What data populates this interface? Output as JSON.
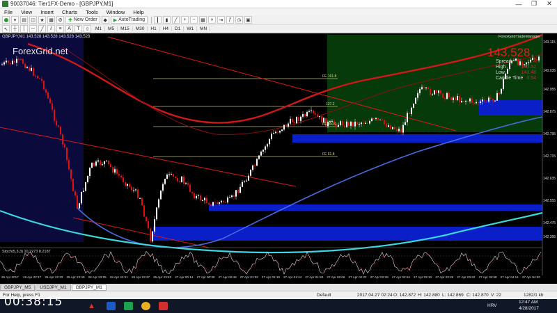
{
  "window": {
    "title": "90037046: Tier1FX-Demo - [GBPJPY,M1]",
    "controls": [
      "—",
      "❐",
      "✕"
    ]
  },
  "menu": [
    "File",
    "View",
    "Insert",
    "Charts",
    "Tools",
    "Window",
    "Help"
  ],
  "toolbar": {
    "new_order_label": "New Order",
    "autotrading_label": "AutoTrading",
    "timeframes": [
      "M1",
      "M5",
      "M15",
      "M30",
      "H1",
      "H4",
      "D1",
      "W1",
      "MN"
    ]
  },
  "chart": {
    "header": "GBPJPY,M1  143.528 143.528 143.528 143.528",
    "watermark": "ForexGrid.net",
    "manager_label": "ForexGridTradeManager",
    "current_price": "143.528",
    "info": [
      {
        "label": "Spread",
        "value": "2.4"
      },
      {
        "label": "High",
        "value": "143.52"
      },
      {
        "label": "Low",
        "value": "143.48"
      },
      {
        "label": "Candle Time",
        "value": "0:54"
      }
    ],
    "fib_labels": [
      "FE 161.8",
      "127.2",
      "FE 100.0",
      "FE 61.8"
    ],
    "stoch_label": "Stoch(5,3,3) 10.2273 8.2187",
    "price_axis": [
      "143.115",
      "143.035",
      "142.955",
      "142.875",
      "142.795",
      "142.715",
      "142.635",
      "142.555",
      "142.475",
      "142.395"
    ],
    "time_axis": [
      "26 Apr 2017",
      "26 Apr 22:17",
      "26 Apr 22:33",
      "26 Apr 22:49",
      "26 Apr 23:05",
      "26 Apr 23:21",
      "26 Apr 23:37",
      "26 Apr 23:53",
      "27 Apr 00:14",
      "27 Apr 00:30",
      "27 Apr 00:46",
      "27 Apr 01:02",
      "27 Apr 01:18",
      "27 Apr 01:34",
      "27 Apr 01:50",
      "27 Apr 02:06",
      "27 Apr 02:22",
      "27 Apr 02:38",
      "27 Apr 02:54",
      "27 Apr 03:10",
      "27 Apr 03:26",
      "27 Apr 03:42",
      "27 Apr 03:58",
      "27 Apr 04:14",
      "27 Apr 04:30"
    ]
  },
  "tabs": [
    "GBPJPY_M5",
    "USDJPY_M1",
    "GBPJPY_M1"
  ],
  "status": {
    "help": "For Help, press F1",
    "profile": "Default",
    "datetime": "2017.04.27 02:24",
    "open": "O: 142.872",
    "high": "H: 142.880",
    "low": "L: 142.869",
    "close": "C: 142.870",
    "volume": "V: 22",
    "traffic": "1282/1 kb"
  },
  "overlay_timer": "00:38:15",
  "tray": {
    "lang": "HRV",
    "time": "12:47 AM",
    "date": "4/28/2017"
  },
  "colors": {
    "candle_up": "#ffffff",
    "candle_down": "#e01010",
    "zone_blue": "#0a1fc8",
    "ma_red": "#d01818",
    "ma_cyan": "#3ad8e0"
  }
}
